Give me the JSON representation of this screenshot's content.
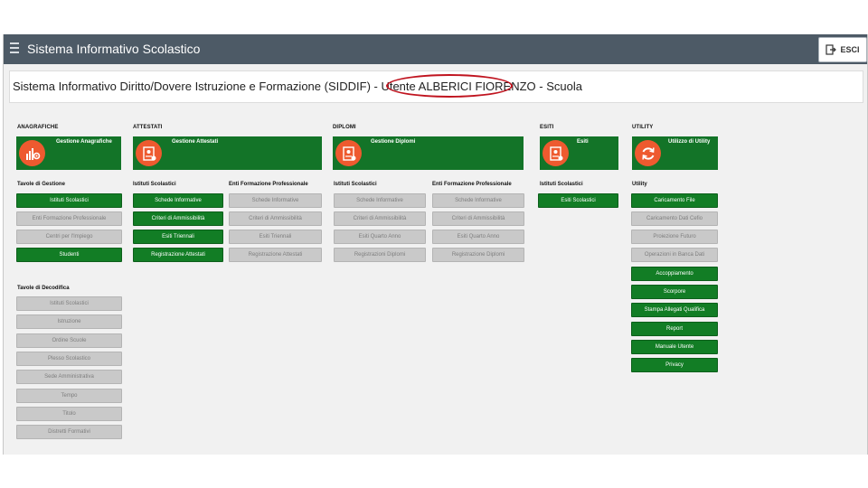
{
  "header": {
    "app_title": "Sistema Informativo Scolastico",
    "exit_label": "ESCI",
    "page_title": "Sistema Informativo Diritto/Dovere Istruzione e Formazione (SIDDIF) - Utente ALBERICI FIORENZO - Scuola"
  },
  "sections": {
    "anagrafiche": "ANAGRAFICHE",
    "attestati": "ATTESTATI",
    "diplomi": "DIPLOMI",
    "esiti": "ESITI",
    "utility": "UTILITY"
  },
  "tiles": {
    "anagrafiche": "Gestione Anagrafiche",
    "attestati": "Gestione Attestati",
    "diplomi": "Gestione Diplomi",
    "esiti": "Esiti",
    "utility": "Utilizzo di Utility"
  },
  "columns": {
    "tavole_gestione": "Tavole di Gestione",
    "tavole_decodifica": "Tavole di Decodifica",
    "att_istituti": "Istituti Scolastici",
    "att_enti": "Enti Formazione Professionale",
    "dip_istituti": "Istituti Scolastici",
    "dip_enti": "Enti Formazione Professionale",
    "esiti_istituti": "Istituti Scolastici",
    "utility": "Utility"
  },
  "buttons": {
    "gestione": [
      "Istituti Scolastici",
      "Enti Formazione Professionale",
      "Centri per l'Impiego",
      "Studenti"
    ],
    "decodifica": [
      "Istituti Scolastici",
      "Istruzione",
      "Ordine Scuole",
      "Plesso Scolastico",
      "Sede Amministrativa",
      "Tempo",
      "Titolo",
      "Distretti Formativi"
    ],
    "att_istituti": [
      "Schede Informative",
      "Criteri di Ammissibilità",
      "Esiti Triennali",
      "Registrazione Attestati"
    ],
    "att_enti": [
      "Schede Informative",
      "Criteri di Ammissibilità",
      "Esiti Triennali",
      "Registrazione Attestati"
    ],
    "dip_istituti": [
      "Schede Informative",
      "Criteri di Ammissibilità",
      "Esiti Quarto Anno",
      "Registrazioni Diplomi"
    ],
    "dip_enti": [
      "Schede Informative",
      "Criteri di Ammissibilità",
      "Esiti Quarto Anno",
      "Registrazione Diplomi"
    ],
    "esiti": [
      "Esiti Scolastici"
    ],
    "utility": [
      "Caricamento File",
      "Caricamento Dati Cefio",
      "Proiezione Futuro",
      "Operazioni in Banca Dati",
      "Accoppiamento",
      "Scorpore",
      "Stampa Allegati Qualifica",
      "Report",
      "Manuale Utente",
      "Privacy"
    ]
  },
  "colors": {
    "topbar": "#4d5a66",
    "tile_green": "#137428",
    "button_green": "#127d25",
    "button_disabled": "#c9c9c9",
    "icon_orange": "#ee5a2f",
    "highlight_red": "#c0141f"
  }
}
